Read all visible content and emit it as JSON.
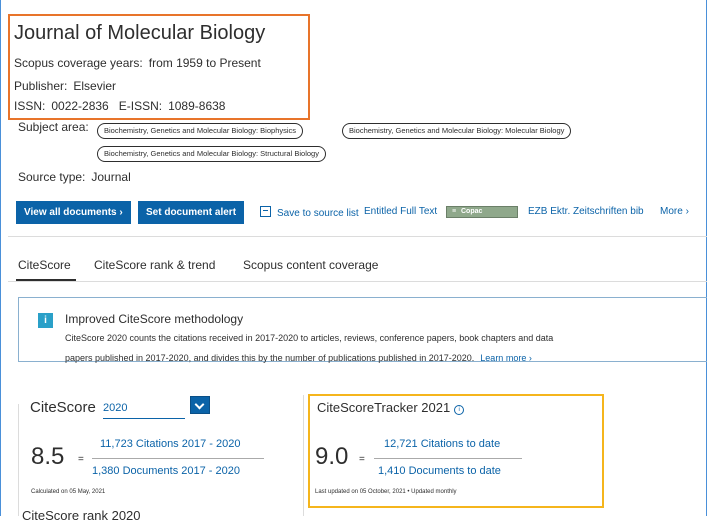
{
  "header": {
    "title": "Journal of Molecular Biology",
    "coverage_label": "Scopus coverage years:",
    "coverage_value": "from 1959 to Present",
    "publisher_label": "Publisher:",
    "publisher_value": "Elsevier",
    "issn_label": "ISSN:",
    "issn_value": "0022-2836",
    "eissn_label": "E-ISSN:",
    "eissn_value": "1089-8638",
    "subject_label": "Subject area:",
    "subjects": [
      "Biochemistry, Genetics and Molecular Biology: Biophysics",
      "Biochemistry, Genetics and Molecular Biology: Molecular Biology",
      "Biochemistry, Genetics and Molecular Biology: Structural Biology"
    ],
    "source_type_label": "Source type:",
    "source_type_value": "Journal"
  },
  "actions": {
    "view_all": "View all documents",
    "view_all_icon": "chevron-right",
    "set_alert": "Set document alert",
    "save_to_list": "Save to source list",
    "entitled": "Entitled Full Text",
    "copac": "Copac",
    "ezb": "EZB Ektr. Zeitschriften bib",
    "more": "More"
  },
  "tabs": [
    "CiteScore",
    "CiteScore rank & trend",
    "Scopus content coverage"
  ],
  "info": {
    "icon": "i",
    "title": "Improved CiteScore methodology",
    "line1": "CiteScore 2020 counts the citations received in 2017-2020 to articles, reviews, conference papers, book chapters and data",
    "line2": "papers published in 2017-2020, and divides this by the number of publications published in 2017-2020.",
    "learn_more": "Learn more"
  },
  "citescore": {
    "label": "CiteScore",
    "year": "2020",
    "value": "8.5",
    "equals": "=",
    "numerator": "11,723 Citations 2017 - 2020",
    "denominator": "1,380 Documents 2017 - 2020",
    "calculated": "Calculated on 05 May, 2021"
  },
  "tracker": {
    "label": "CiteScoreTracker 2021",
    "value": "9.0",
    "equals": "=",
    "numerator": "12,721 Citations to date",
    "denominator": "1,410 Documents to date",
    "updated": "Last updated on 05 October, 2021 • Updated monthly"
  },
  "next_heading": "CiteScore rank 2020",
  "colors": {
    "primary": "#0b63a8",
    "highlight_orange": "#e8742a",
    "highlight_yellow": "#f5b51c",
    "info_icon": "#2aa0c8"
  }
}
